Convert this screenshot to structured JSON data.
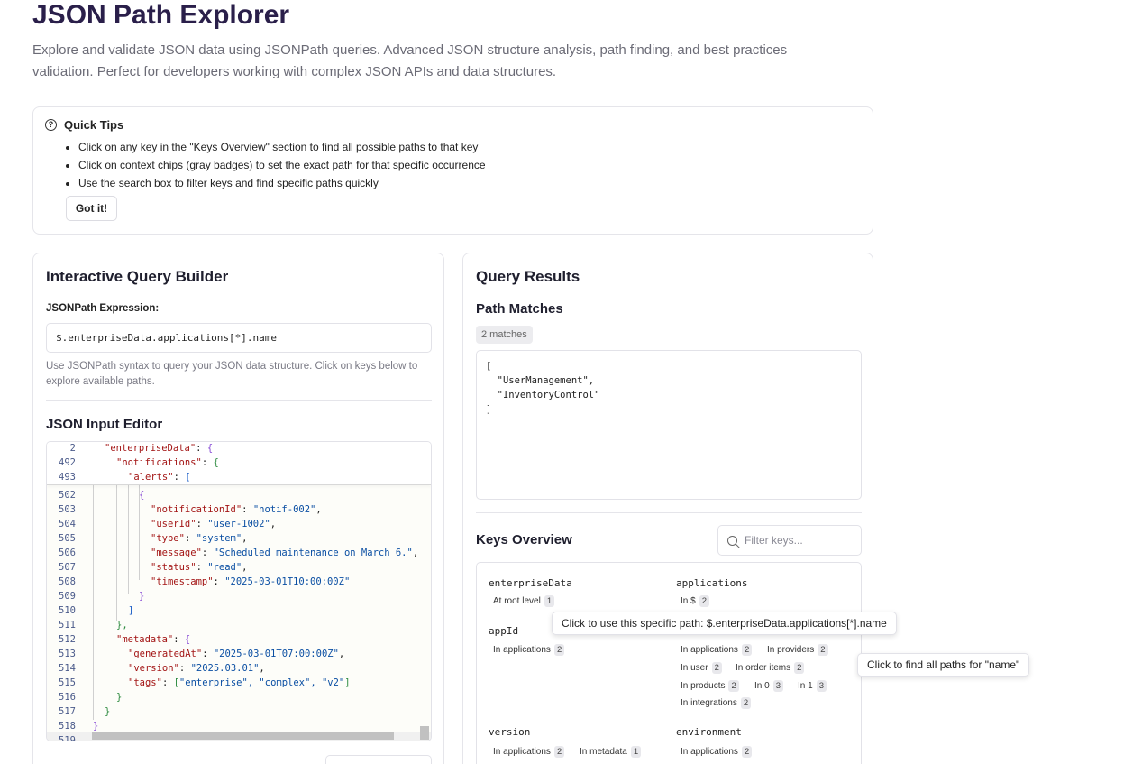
{
  "header": {
    "title": "JSON Path Explorer",
    "description": "Explore and validate JSON data using JSONPath queries. Advanced JSON structure analysis, path finding, and best practices validation. Perfect for developers working with complex JSON APIs and data structures."
  },
  "tips": {
    "title": "Quick Tips",
    "items": [
      "Click on any key in the \"Keys Overview\" section to find all possible paths to that key",
      "Click on context chips (gray badges) to set the exact path for that specific occurrence",
      "Use the search box to filter keys and find specific paths quickly"
    ],
    "button": "Got it!"
  },
  "builder": {
    "title": "Interactive Query Builder",
    "expression_label": "JSONPath Expression:",
    "expression_value": "$.enterpriseData.applications[*].name",
    "help": "Use JSONPath syntax to query your JSON data structure. Click on keys below to explore available paths.",
    "editor_title": "JSON Input Editor",
    "sticky_lines": [
      {
        "n": "2",
        "key": "\"enterpriseData\"",
        "after": ": ",
        "bracket": "{"
      },
      {
        "n": "492",
        "key": "\"notifications\"",
        "after": ": ",
        "bracket": "{"
      },
      {
        "n": "493",
        "key": "\"alerts\"",
        "after": ": ",
        "bracket": "["
      }
    ],
    "code_lines": [
      {
        "n": "502",
        "t": "{"
      },
      {
        "n": "503",
        "k": "\"notificationId\"",
        "v": "\"notif-002\"",
        "c": ","
      },
      {
        "n": "504",
        "k": "\"userId\"",
        "v": "\"user-1002\"",
        "c": ","
      },
      {
        "n": "505",
        "k": "\"type\"",
        "v": "\"system\"",
        "c": ","
      },
      {
        "n": "506",
        "k": "\"message\"",
        "v": "\"Scheduled maintenance on March 6.\"",
        "c": ","
      },
      {
        "n": "507",
        "k": "\"status\"",
        "v": "\"read\"",
        "c": ","
      },
      {
        "n": "508",
        "k": "\"timestamp\"",
        "v": "\"2025-03-01T10:00:00Z\"",
        "c": ""
      },
      {
        "n": "509",
        "t": "}"
      },
      {
        "n": "510",
        "t": "]"
      },
      {
        "n": "511",
        "t": "},"
      },
      {
        "n": "512",
        "k": "\"metadata\"",
        "v": "{",
        "c": ""
      },
      {
        "n": "513",
        "k": "\"generatedAt\"",
        "v": "\"2025-03-01T07:00:00Z\"",
        "c": ","
      },
      {
        "n": "514",
        "k": "\"version\"",
        "v": "\"2025.03.01\"",
        "c": ","
      },
      {
        "n": "515",
        "k": "\"tags\"",
        "v": "[\"enterprise\", \"complex\", \"v2\"]",
        "c": ""
      },
      {
        "n": "516",
        "t": "}"
      },
      {
        "n": "517",
        "t": "}"
      },
      {
        "n": "518",
        "t": "}"
      },
      {
        "n": "519",
        "t": ""
      }
    ]
  },
  "results": {
    "title": "Query Results",
    "matches_title": "Path Matches",
    "matches_badge": "2 matches",
    "output": "[\n  \"UserManagement\",\n  \"InventoryControl\"\n]",
    "keys_title": "Keys Overview",
    "filter_placeholder": "Filter keys...",
    "keys": {
      "enterpriseData": {
        "name": "enterpriseData",
        "chips": [
          {
            "label": "At root level",
            "count": "1"
          }
        ]
      },
      "applications": {
        "name": "applications",
        "chips": [
          {
            "label": "In $",
            "count": "2"
          }
        ]
      },
      "appId": {
        "name": "appId",
        "chips": [
          {
            "label": "In applications",
            "count": "2"
          }
        ]
      },
      "name": {
        "chips": [
          {
            "label": "In applications",
            "count": "2"
          },
          {
            "label": "In providers",
            "count": "2"
          },
          {
            "label": "In user",
            "count": "2"
          },
          {
            "label": "In order items",
            "count": "2"
          },
          {
            "label": "In products",
            "count": "2"
          },
          {
            "label": "In 0",
            "count": "3"
          },
          {
            "label": "In 1",
            "count": "3"
          },
          {
            "label": "In integrations",
            "count": "2"
          }
        ]
      },
      "version": {
        "name": "version",
        "chips": [
          {
            "label": "In applications",
            "count": "2"
          },
          {
            "label": "In metadata",
            "count": "1"
          }
        ]
      },
      "environment": {
        "name": "environment",
        "chips": [
          {
            "label": "In applications",
            "count": "2"
          }
        ]
      }
    },
    "tooltip_path": "Click to use this specific path: $.enterpriseData.applications[*].name",
    "tooltip_key": "Click to find all paths for \"name\""
  }
}
